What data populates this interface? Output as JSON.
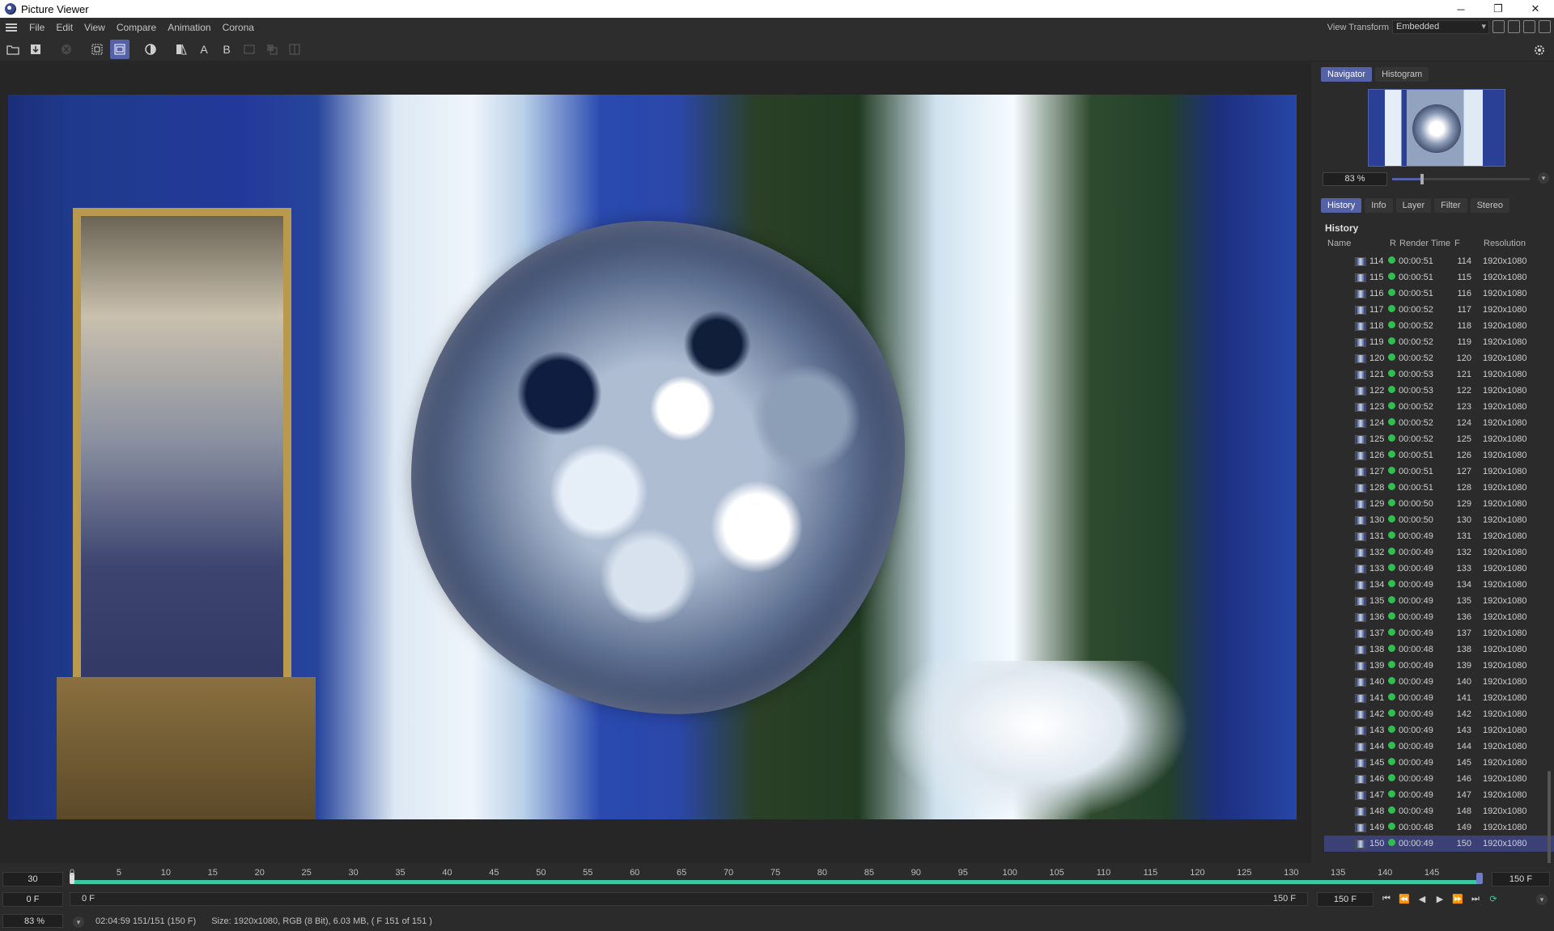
{
  "window": {
    "title": "Picture Viewer",
    "minimize": "─",
    "maximize": "❐",
    "close": "✕"
  },
  "menu": [
    "File",
    "Edit",
    "View",
    "Compare",
    "Animation",
    "Corona"
  ],
  "view_transform": {
    "label": "View Transform",
    "value": "Embedded"
  },
  "toolbar": {
    "letter_a": "A",
    "letter_b": "B"
  },
  "panel": {
    "top_tabs": [
      "Navigator",
      "Histogram"
    ],
    "zoom": "83 %",
    "zoom_fraction": 0.22,
    "sub_tabs": [
      "History",
      "Info",
      "Layer",
      "Filter",
      "Stereo"
    ],
    "history_title": "History",
    "columns": {
      "name": "Name",
      "r": "R",
      "render_time": "Render Time",
      "f": "F",
      "resolution": "Resolution"
    },
    "rows": [
      {
        "n": "114",
        "t": "00:00:51",
        "f": "114",
        "r": "1920x1080"
      },
      {
        "n": "115",
        "t": "00:00:51",
        "f": "115",
        "r": "1920x1080"
      },
      {
        "n": "116",
        "t": "00:00:51",
        "f": "116",
        "r": "1920x1080"
      },
      {
        "n": "117",
        "t": "00:00:52",
        "f": "117",
        "r": "1920x1080"
      },
      {
        "n": "118",
        "t": "00:00:52",
        "f": "118",
        "r": "1920x1080"
      },
      {
        "n": "119",
        "t": "00:00:52",
        "f": "119",
        "r": "1920x1080"
      },
      {
        "n": "120",
        "t": "00:00:52",
        "f": "120",
        "r": "1920x1080"
      },
      {
        "n": "121",
        "t": "00:00:53",
        "f": "121",
        "r": "1920x1080"
      },
      {
        "n": "122",
        "t": "00:00:53",
        "f": "122",
        "r": "1920x1080"
      },
      {
        "n": "123",
        "t": "00:00:52",
        "f": "123",
        "r": "1920x1080"
      },
      {
        "n": "124",
        "t": "00:00:52",
        "f": "124",
        "r": "1920x1080"
      },
      {
        "n": "125",
        "t": "00:00:52",
        "f": "125",
        "r": "1920x1080"
      },
      {
        "n": "126",
        "t": "00:00:51",
        "f": "126",
        "r": "1920x1080"
      },
      {
        "n": "127",
        "t": "00:00:51",
        "f": "127",
        "r": "1920x1080"
      },
      {
        "n": "128",
        "t": "00:00:51",
        "f": "128",
        "r": "1920x1080"
      },
      {
        "n": "129",
        "t": "00:00:50",
        "f": "129",
        "r": "1920x1080"
      },
      {
        "n": "130",
        "t": "00:00:50",
        "f": "130",
        "r": "1920x1080"
      },
      {
        "n": "131",
        "t": "00:00:49",
        "f": "131",
        "r": "1920x1080"
      },
      {
        "n": "132",
        "t": "00:00:49",
        "f": "132",
        "r": "1920x1080"
      },
      {
        "n": "133",
        "t": "00:00:49",
        "f": "133",
        "r": "1920x1080"
      },
      {
        "n": "134",
        "t": "00:00:49",
        "f": "134",
        "r": "1920x1080"
      },
      {
        "n": "135",
        "t": "00:00:49",
        "f": "135",
        "r": "1920x1080"
      },
      {
        "n": "136",
        "t": "00:00:49",
        "f": "136",
        "r": "1920x1080"
      },
      {
        "n": "137",
        "t": "00:00:49",
        "f": "137",
        "r": "1920x1080"
      },
      {
        "n": "138",
        "t": "00:00:48",
        "f": "138",
        "r": "1920x1080"
      },
      {
        "n": "139",
        "t": "00:00:49",
        "f": "139",
        "r": "1920x1080"
      },
      {
        "n": "140",
        "t": "00:00:49",
        "f": "140",
        "r": "1920x1080"
      },
      {
        "n": "141",
        "t": "00:00:49",
        "f": "141",
        "r": "1920x1080"
      },
      {
        "n": "142",
        "t": "00:00:49",
        "f": "142",
        "r": "1920x1080"
      },
      {
        "n": "143",
        "t": "00:00:49",
        "f": "143",
        "r": "1920x1080"
      },
      {
        "n": "144",
        "t": "00:00:49",
        "f": "144",
        "r": "1920x1080"
      },
      {
        "n": "145",
        "t": "00:00:49",
        "f": "145",
        "r": "1920x1080"
      },
      {
        "n": "146",
        "t": "00:00:49",
        "f": "146",
        "r": "1920x1080"
      },
      {
        "n": "147",
        "t": "00:00:49",
        "f": "147",
        "r": "1920x1080"
      },
      {
        "n": "148",
        "t": "00:00:49",
        "f": "148",
        "r": "1920x1080"
      },
      {
        "n": "149",
        "t": "00:00:48",
        "f": "149",
        "r": "1920x1080"
      },
      {
        "n": "150",
        "t": "00:00:49",
        "f": "150",
        "r": "1920x1080"
      }
    ],
    "selected_row": "150"
  },
  "timeline": {
    "fps": "30",
    "end_frame": "150 F",
    "current": "0 F",
    "range_start": "0 F",
    "range_end": "150 F",
    "frame_field": "150 F",
    "ticks": [
      0,
      5,
      10,
      15,
      20,
      25,
      30,
      35,
      40,
      45,
      50,
      55,
      60,
      65,
      70,
      75,
      80,
      85,
      90,
      95,
      100,
      105,
      110,
      115,
      120,
      125,
      130,
      135,
      140,
      145
    ],
    "max": 150
  },
  "status": {
    "zoom": "83 %",
    "time": "02:04:59 151/151 (150 F)",
    "info": "Size: 1920x1080, RGB (8 Bit), 6.03 MB,  ( F 151 of 151 )"
  }
}
